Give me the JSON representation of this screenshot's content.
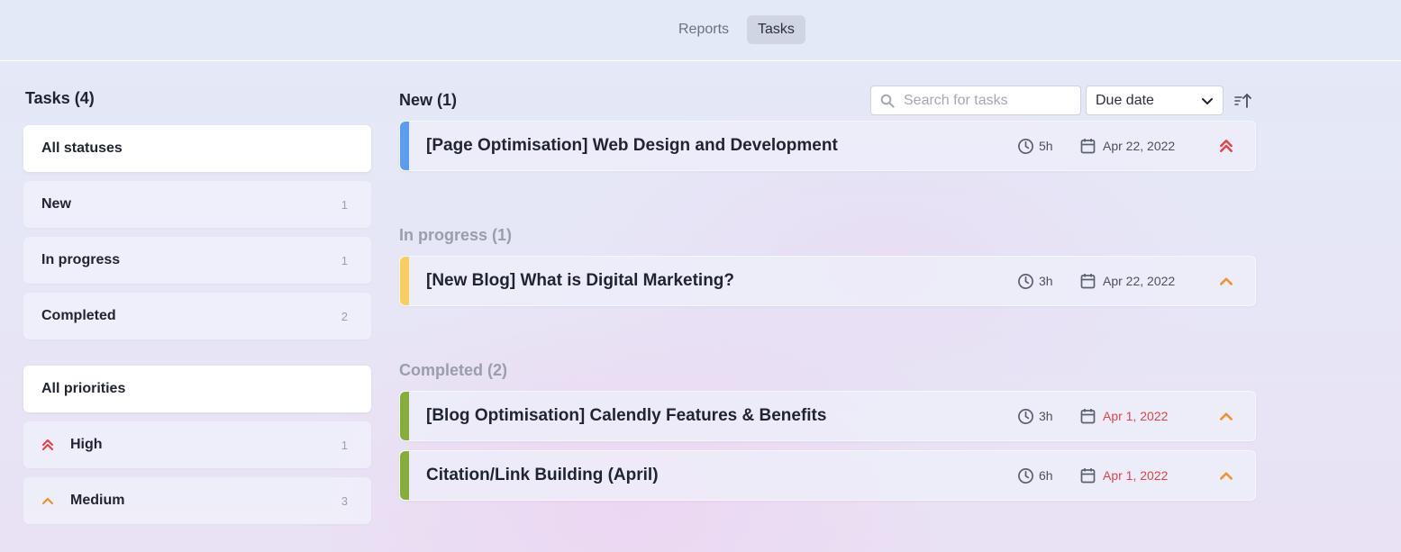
{
  "nav": {
    "tabs": [
      {
        "label": "Reports",
        "active": false
      },
      {
        "label": "Tasks",
        "active": true
      }
    ]
  },
  "sidebar": {
    "title": "Tasks (4)",
    "statuses": [
      {
        "label": "All statuses",
        "count": "",
        "active": true
      },
      {
        "label": "New",
        "count": "1",
        "active": false
      },
      {
        "label": "In progress",
        "count": "1",
        "active": false
      },
      {
        "label": "Completed",
        "count": "2",
        "active": false
      }
    ],
    "priorities": [
      {
        "label": "All priorities",
        "count": "",
        "active": true
      },
      {
        "label": "High",
        "count": "1",
        "icon": "double-chevron-up-icon"
      },
      {
        "label": "Medium",
        "count": "3",
        "icon": "chevron-up-icon"
      }
    ]
  },
  "toolbar": {
    "search_placeholder": "Search for tasks",
    "search_value": "",
    "sort_by": "Due date"
  },
  "groups": [
    {
      "title": "New (1)",
      "tasks": [
        {
          "title": "[Page Optimisation] Web Design and Development",
          "hours": "5h",
          "due": "Apr 22, 2022",
          "overdue": false,
          "priority": "high",
          "stripe_color": "#5b9cf0"
        }
      ]
    },
    {
      "title": "In progress (1)",
      "tasks": [
        {
          "title": "[New Blog] What is Digital Marketing?",
          "hours": "3h",
          "due": "Apr 22, 2022",
          "overdue": false,
          "priority": "medium",
          "stripe_color": "#f6cf5e"
        }
      ]
    },
    {
      "title": "Completed (2)",
      "tasks": [
        {
          "title": "[Blog Optimisation] Calendly Features & Benefits",
          "hours": "3h",
          "due": "Apr 1, 2022",
          "overdue": true,
          "priority": "medium",
          "stripe_color": "#86ad3a"
        },
        {
          "title": "Citation/Link Building (April)",
          "hours": "6h",
          "due": "Apr 1, 2022",
          "overdue": true,
          "priority": "medium",
          "stripe_color": "#86ad3a"
        }
      ]
    }
  ],
  "colors": {
    "high_priority": "#e0454b",
    "medium_priority": "#f0902e",
    "overdue": "#e0454b"
  }
}
